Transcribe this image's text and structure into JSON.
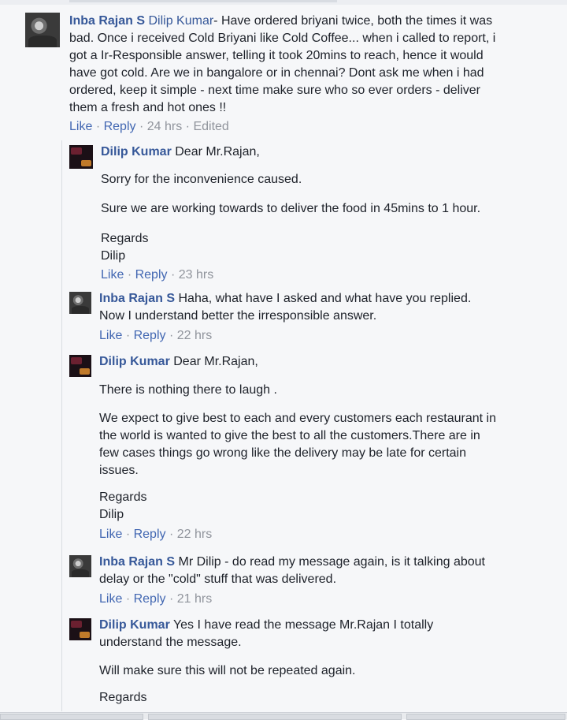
{
  "comments": [
    {
      "author": "Inba Rajan S",
      "mention": "Dilip Kumar",
      "lines": [
        "- Have ordered briyani twice, both the times it was",
        "bad. Once i received Cold Briyani like Cold Coffee... when i called to report, i",
        "got a Ir-Responsible answer, telling it took 20mins to reach, hence it would",
        "have got cold. Are we in bangalore or in chennai? Dont ask me when i had",
        "ordered, keep it simple - next time make sure who so ever orders - deliver",
        "them a fresh and hot ones !!"
      ],
      "like": "Like",
      "reply": "Reply",
      "time": "24 hrs",
      "edited": "Edited"
    }
  ],
  "replies": [
    {
      "author": "Dilip Kumar",
      "first": "Dear Mr.Rajan,",
      "p1": "Sorry for the inconvenience caused.",
      "p2": "Sure we are working towards to deliver the food in 45mins to 1 hour.",
      "p3a": "Regards",
      "p3b": "Dilip",
      "like": "Like",
      "reply": "Reply",
      "time": "23 hrs"
    },
    {
      "author": "Inba Rajan S",
      "first": "Haha, what have I asked and what have you replied.",
      "line2": "Now I understand better the irresponsible answer.",
      "like": "Like",
      "reply": "Reply",
      "time": "22 hrs"
    },
    {
      "author": "Dilip Kumar",
      "first": "Dear Mr.Rajan,",
      "p1": "There is nothing there to laugh .",
      "p2": [
        "We expect to give best to each and every customers each restaurant in",
        "the world is wanted to give the best to all the customers.There are in",
        "few cases things go wrong like the delivery may be late for certain",
        "issues."
      ],
      "p3a": "Regards",
      "p3b": "Dilip",
      "like": "Like",
      "reply": "Reply",
      "time": "22 hrs"
    },
    {
      "author": "Inba Rajan S",
      "first": "Mr Dilip - do read my message again, is it talking about",
      "line2": "delay or the \"cold\" stuff that was delivered.",
      "like": "Like",
      "reply": "Reply",
      "time": "21 hrs"
    },
    {
      "author": "Dilip Kumar",
      "first": "Yes I have read the message Mr.Rajan I totally",
      "line2": "understand the message.",
      "p1": "Will make sure this will not be repeated again.",
      "p2": "Regards"
    }
  ],
  "separator": "·"
}
